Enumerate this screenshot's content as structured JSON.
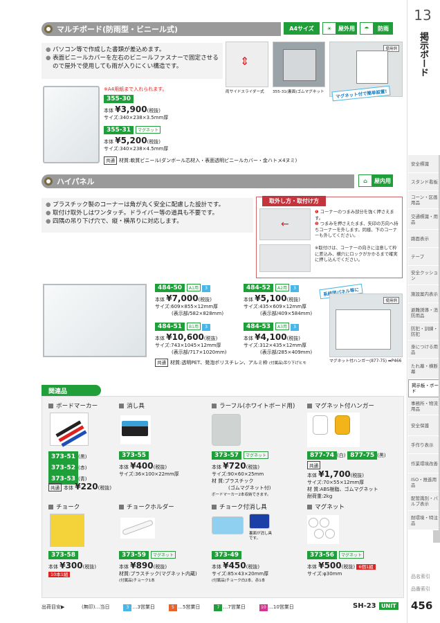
{
  "index": {
    "chapter_number": "13",
    "chapter_title": "掲示ボード",
    "tabs": [
      "安全標識",
      "スタンド看板",
      "コーン・区画用品",
      "交通標識・用品",
      "路面表示",
      "テープ",
      "安全クッション",
      "施設案内表示",
      "避難誘導・消防用品",
      "防犯・訓練・防犯",
      "身につける用品",
      "たれ幕・横断幕",
      "掲示板・ボード",
      "事務所・物流用品",
      "安全保護",
      "手作り表示",
      "作業環境改善",
      "ISO・推進用品",
      "配管識別・バルブ表示",
      "耐環境・特注品"
    ],
    "active_tab": "掲示板・ボード",
    "bottom_links": [
      "品名索引",
      "品番索引"
    ]
  },
  "multi": {
    "title": "マルチボード(防雨型・ビニール式)",
    "badges": {
      "a4": "A4サイズ",
      "outdoor": "屋外用",
      "rain": "防雨"
    },
    "bullets": [
      "パソコン等で作成した書類が差込めます。",
      "表面ビニールカバーを左右のビニールファスナーで固定させるので屋外で使用しても雨が入りにくい構造です。"
    ],
    "cap1": "両サイドスライダー式",
    "cap2": "355-31(裏面)ゴムマグネット",
    "cap3": "マグネット付で簡単設置!",
    "usage": "使用例",
    "note_a4": "※A4用紙まで入れられます。",
    "p1": {
      "code": "355-30",
      "price_label": "本体",
      "price": "¥3,900",
      "tax": "(税抜)",
      "size": "サイズ:340×238×3.5mm厚"
    },
    "p2": {
      "code": "355-31",
      "magnet": "マグネット",
      "price_label": "本体",
      "price": "¥5,200",
      "tax": "(税抜)",
      "size": "サイズ:340×238×4.5mm厚"
    },
    "common": "共通",
    "material": "材質:軟質ビニール(ダンボール芯材入・表面透明ビニールカバー・金ハトメ4ヌミ)"
  },
  "hipanel": {
    "title": "ハイパネル",
    "badge_indoor": "屋内用",
    "bullets": [
      "プラスチック製のコーナーは角が丸く安全に配慮した設計です。",
      "取付け取外しはワンタッチ。ドライバー等の道具も不要です。",
      "四隅の吊り下げ穴で、縦・横吊りに対応します。"
    ],
    "howto_title": "取外し方・取付け方",
    "howto_notes": [
      "コーナーのつまみ部分を強く押さえます。",
      "つまみを押さえたまま、矢印の方向へ持ちコーナーを外します。同様、下のコーナーも外してください。"
    ],
    "howto_extra": "※取付けは、コーナーの向きに注意して枠に差込み、横穴にロックがかかるまで確実に押し込んでください。",
    "system_label": "系統図パネル等に",
    "usage": "使用例",
    "hanger_note": "マグネット付ハンガー(877-75) ➡P466",
    "products": [
      {
        "code": "484-50",
        "size_tag": "A1用",
        "days": "3",
        "price": "¥7,000",
        "tax": "(税抜)",
        "size": "サイズ:609×855×12mm厚",
        "display": "(表示部/582×828mm)"
      },
      {
        "code": "484-52",
        "size_tag": "A2用",
        "days": "3",
        "price": "¥5,100",
        "tax": "(税抜)",
        "size": "サイズ:435×609×12mm厚",
        "display": "(表示部/409×584mm)"
      },
      {
        "code": "484-51",
        "size_tag": "B1用",
        "days": "3",
        "price": "¥10,600",
        "tax": "(税抜)",
        "size": "サイズ:743×1045×12mm厚",
        "display": "(表示部/717×1020mm)"
      },
      {
        "code": "484-53",
        "size_tag": "A3用",
        "days": "3",
        "price": "¥4,100",
        "tax": "(税抜)",
        "size": "サイズ:312×435×12mm厚",
        "display": "(表示部/285×409mm)"
      }
    ],
    "price_label": "本体",
    "common": "共通",
    "material": "材質:透明PET、発泡ポリスチレン、アルミ枠",
    "material_note": "(付属品)吊り下げヒモ"
  },
  "related": {
    "title": "関連品",
    "items": {
      "marker": {
        "name": "ボードマーカー",
        "codes": [
          [
            "373-51",
            "(黒)"
          ],
          [
            "373-52",
            "(赤)"
          ],
          [
            "373-53",
            "(青)"
          ]
        ],
        "common": "共通",
        "price_label": "本体",
        "price": "¥220",
        "tax": "(税抜)"
      },
      "eraser": {
        "name": "消し具",
        "code": "373-55",
        "price_label": "本体",
        "price": "¥400",
        "tax": "(税抜)",
        "size": "サイズ:36×100×22mm厚"
      },
      "raffle": {
        "name": "ラーフル(ホワイトボード用)",
        "code": "373-57",
        "magnet": "マグネット",
        "price_label": "本体",
        "price": "¥720",
        "tax": "(税抜)",
        "size": "サイズ:90×60×25mm",
        "material": "材 質:プラスチック",
        "material2": "(ゴムマグネット付)",
        "note": "ボードマーカー2本収納できます。"
      },
      "hanger": {
        "name": "マグネット付ハンガー",
        "code1": "877-74",
        "c1": "(白)",
        "code2": "877-75",
        "c2": "(黒)",
        "common": "共通",
        "price_label": "本体",
        "price": "¥1,700",
        "tax": "(税抜)",
        "size": "サイズ:70×55×12mm厚",
        "material": "材 質:ABS樹脂、ゴムマグネット",
        "load": "耐荷重:2kg"
      },
      "chalk": {
        "name": "チョーク",
        "code": "373-58",
        "price_label": "本体",
        "price": "¥300",
        "tax": "(税抜)",
        "pack": "10本1組"
      },
      "holder": {
        "name": "チョークホルダー",
        "code": "373-59",
        "magnet": "マグネット",
        "price_label": "本体",
        "price": "¥890",
        "tax": "(税抜)",
        "material": "材質:プラスチック(マグネット内蔵)",
        "note": "(付属品)チョーク1本"
      },
      "chalk_eraser": {
        "name": "チョーク付消し具",
        "code": "373-49",
        "price_label": "本体",
        "price": "¥450",
        "tax": "(税抜)",
        "size": "サイズ:85×43×20mm厚",
        "note": "(付属品)チョーク白2本、赤1本",
        "img_note": "裏面が消し具です。"
      },
      "magnet": {
        "name": "マグネット",
        "code": "373-56",
        "magnet": "マグネット",
        "price_label": "本体",
        "price": "¥500",
        "tax": "(税抜)",
        "pack": "6個1組",
        "size": "サイズ:φ30mm"
      }
    }
  },
  "footer": {
    "shipping_label": "出荷目安▶",
    "items": [
      [
        "",
        "(無印)…当日"
      ],
      [
        "3",
        "…3営業日"
      ],
      [
        "5",
        "…5営業日"
      ],
      [
        "7",
        "…7営業日"
      ],
      [
        "10",
        "…10営業日"
      ]
    ],
    "colors": [
      "",
      "#49b6e6",
      "#e9632b",
      "#1f9e3a",
      "#d6358f"
    ],
    "page_code": "SH-23",
    "brand": "UNIT",
    "page_number": "456"
  }
}
